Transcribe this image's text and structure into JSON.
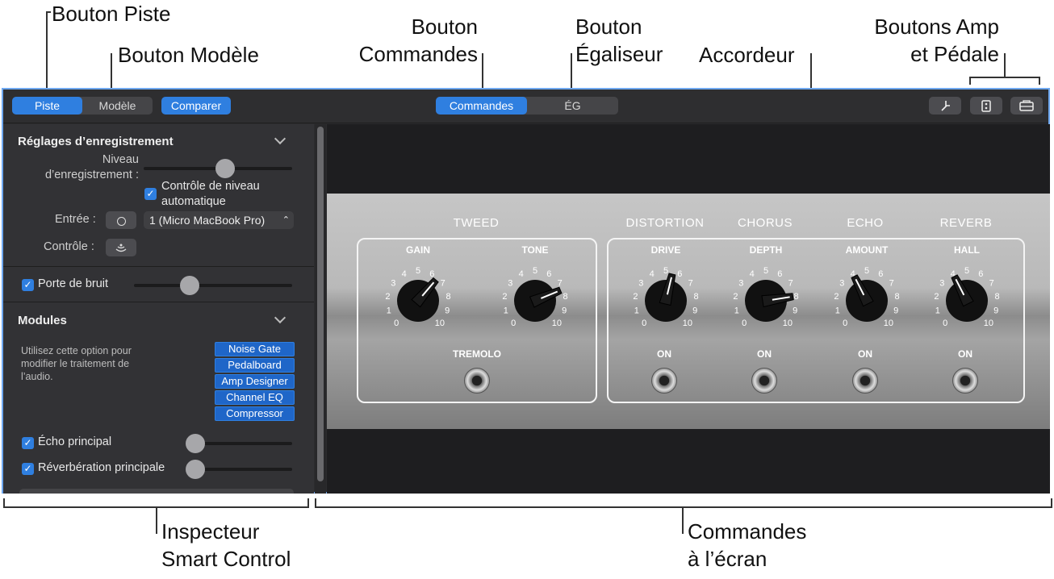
{
  "callouts": {
    "track_button": "Bouton Piste",
    "template_button": "Bouton Modèle",
    "controls_button": [
      "Bouton",
      "Commandes"
    ],
    "eq_button": [
      "Bouton",
      "Égaliseur"
    ],
    "tuner": "Accordeur",
    "amp_pedal_buttons": [
      "Boutons Amp",
      "et Pédale"
    ],
    "inspector": [
      "Inspecteur",
      "Smart Control"
    ],
    "screen_controls": [
      "Commandes",
      "à l’écran"
    ]
  },
  "toolbar": {
    "track": "Piste",
    "template": "Modèle",
    "compare": "Comparer",
    "controls": "Commandes",
    "eq": "ÉG"
  },
  "inspector": {
    "recording_title": "Réglages d’enregistrement",
    "rec_level_label": [
      "Niveau",
      "d’enregistrement :"
    ],
    "rec_level": 0.55,
    "auto_level": [
      "Contrôle de niveau",
      "automatique"
    ],
    "input_label": "Entrée :",
    "input_value": "1 (Micro MacBook Pro)",
    "monitor_label": "Contrôle :",
    "noise_gate": "Porte de bruit",
    "noise_gate_level": 0.35,
    "modules_title": "Modules",
    "modules_help": [
      "Utilisez cette option pour",
      "modifier le traitement de",
      "l’audio."
    ],
    "modules": [
      "Noise Gate",
      "Pedalboard",
      "Amp Designer",
      "Channel EQ",
      "Compressor"
    ],
    "master_echo": "Écho principal",
    "master_reverb": "Réverbération principale"
  },
  "amp": {
    "tweed": "TWEED",
    "distortion": "DISTORTION",
    "chorus": "CHORUS",
    "echo": "ECHO",
    "reverb": "REVERB",
    "knobs": [
      {
        "label": "GAIN",
        "value": 6.5
      },
      {
        "label": "TONE",
        "value": 7.5
      },
      {
        "label": "DRIVE",
        "value": 5.5
      },
      {
        "label": "DEPTH",
        "value": 8.0
      },
      {
        "label": "AMOUNT",
        "value": 4.0
      },
      {
        "label": "HALL",
        "value": 4.0
      }
    ],
    "tremolo": "TREMOLO",
    "on": "ON"
  }
}
